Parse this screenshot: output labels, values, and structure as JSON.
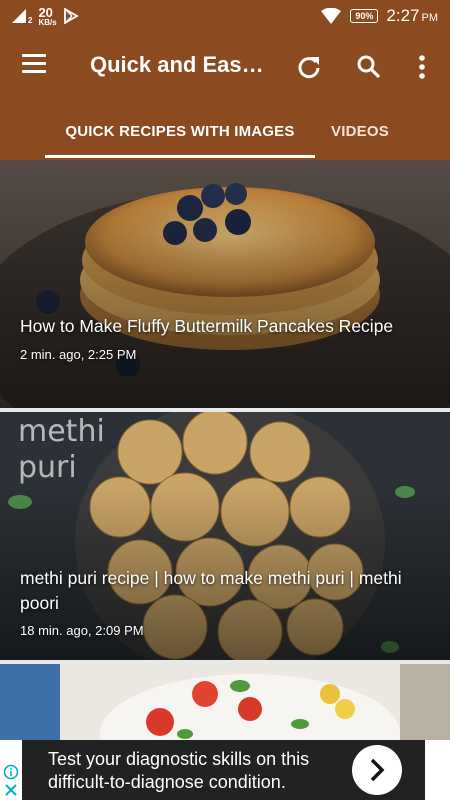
{
  "status_bar": {
    "net_speed_value": "20",
    "net_speed_unit": "KB/s",
    "sim_label": "2",
    "battery": "90%",
    "time": "2:27",
    "ampm": "PM"
  },
  "app_bar": {
    "title": "Quick and Eas…",
    "icons": [
      "menu-icon",
      "refresh-icon",
      "search-icon",
      "more-vert-icon"
    ]
  },
  "tabs": [
    {
      "label": "QUICK RECIPES WITH IMAGES",
      "selected": true
    },
    {
      "label": "VIDEOS",
      "selected": false
    }
  ],
  "cards": [
    {
      "title": "How to Make Fluffy Buttermilk Pancakes Recipe",
      "meta": "2 min. ago, 2:25 PM"
    },
    {
      "image_text": "methi puri",
      "title": "methi puri recipe | how to make methi puri | methi poori",
      "meta": "18 min. ago, 2:09 PM"
    },
    {
      "title": "",
      "meta": ""
    }
  ],
  "ad": {
    "text": "Test your diagnostic skills on this difficult-to-diagnose condition.",
    "icons": [
      "info-icon",
      "close-icon",
      "chevron-right-icon"
    ]
  },
  "colors": {
    "app_bar": "#8b4a1f",
    "tab_indicator": "#ffffff",
    "background": "#e9e9e9"
  }
}
